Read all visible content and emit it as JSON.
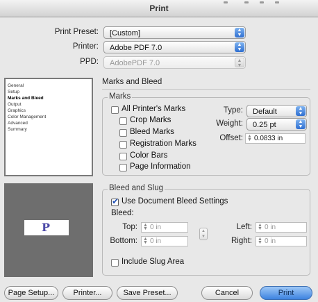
{
  "window": {
    "title": "Print"
  },
  "top_fields": {
    "print_preset": {
      "label": "Print Preset:",
      "value": "[Custom]"
    },
    "printer": {
      "label": "Printer:",
      "value": "Adobe PDF 7.0"
    },
    "ppd": {
      "label": "PPD:",
      "value": "AdobePDF 7.0"
    }
  },
  "sidebar": {
    "items": [
      "General",
      "Setup",
      "Marks and Bleed",
      "Output",
      "Graphics",
      "Color Management",
      "Advanced",
      "Summary"
    ],
    "selected": "Marks and Bleed"
  },
  "panel": {
    "title": "Marks and Bleed",
    "marks": {
      "group_label": "Marks",
      "all_printers_marks": "All Printer's Marks",
      "crop_marks": "Crop Marks",
      "bleed_marks": "Bleed Marks",
      "registration_marks": "Registration Marks",
      "color_bars": "Color Bars",
      "page_information": "Page Information",
      "type_label": "Type:",
      "type_value": "Default",
      "weight_label": "Weight:",
      "weight_value": "0.25 pt",
      "offset_label": "Offset:",
      "offset_value": "0.0833 in"
    },
    "bleed_slug": {
      "group_label": "Bleed and Slug",
      "use_doc_bleed": "Use Document Bleed Settings",
      "bleed_label": "Bleed:",
      "top_label": "Top:",
      "top_value": "0 in",
      "bottom_label": "Bottom:",
      "bottom_value": "0 in",
      "left_label": "Left:",
      "left_value": "0 in",
      "right_label": "Right:",
      "right_value": "0 in",
      "include_slug": "Include Slug Area"
    }
  },
  "preview": {
    "glyph": "P"
  },
  "buttons": {
    "page_setup": "Page Setup...",
    "printer": "Printer...",
    "save_preset": "Save Preset...",
    "cancel": "Cancel",
    "print": "Print"
  },
  "colors": {
    "default_button": "#3d83e0",
    "check": "#1e4fb5",
    "preview_bg": "#6e6e6e"
  }
}
